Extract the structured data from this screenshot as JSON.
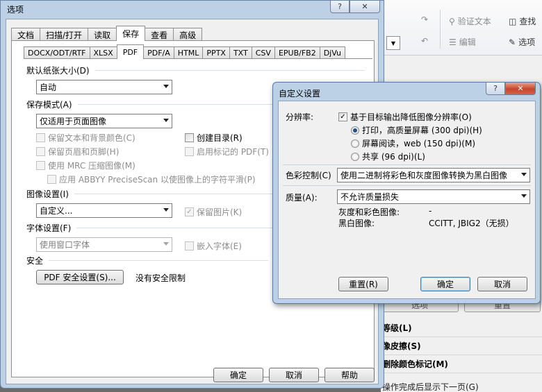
{
  "bg": {
    "toolbar": {
      "verify_text": "验证文本",
      "find": "查找",
      "edit": "编辑",
      "options": "选项"
    },
    "hidden_buttons": [
      "选项",
      "重置"
    ],
    "list_items": [
      "等级(L)",
      "像皮擦(S)",
      "删除颜色标记(M)"
    ],
    "bottom_text": "操作完成后显示下一页(G)"
  },
  "main": {
    "title": "选项",
    "help_glyph": "?",
    "close_glyph": "✕",
    "tabs": [
      "文档",
      "扫描/打开",
      "读取",
      "保存",
      "查看",
      "高级"
    ],
    "active_tab": "保存",
    "format_tabs": [
      "DOCX/ODT/RTF",
      "XLSX",
      "PDF",
      "PDF/A",
      "HTML",
      "PPTX",
      "TXT",
      "CSV",
      "EPUB/FB2",
      "DjVu"
    ],
    "active_format": "PDF",
    "paper_size": {
      "label": "默认纸张大小(D)",
      "value": "自动"
    },
    "save_mode": {
      "label": "保存模式(A)",
      "value": "仅适用于页面图像"
    },
    "checks": {
      "keep_text_bg": {
        "label": "保留文本和背景颜色(C)",
        "checked": false,
        "enabled": false
      },
      "keep_header_footer": {
        "label": "保留页眉和页脚(H)",
        "checked": false,
        "enabled": false
      },
      "use_mrc": {
        "label": "使用 MRC 压缩图像(M)",
        "checked": false,
        "enabled": false
      },
      "abbyy_smooth": {
        "label": "应用 ABBYY PreciseScan 以使图像上的字符平滑(P)",
        "checked": false,
        "enabled": false
      },
      "create_toc": {
        "label": "创建目录(R)",
        "checked": false,
        "enabled": true
      },
      "tagged_pdf": {
        "label": "启用标记的 PDF(T)",
        "checked": false,
        "enabled": false
      },
      "keep_images": {
        "label": "保留图片(K)",
        "checked": true,
        "enabled": false
      },
      "embed_fonts": {
        "label": "嵌入字体(E)",
        "checked": false,
        "enabled": false
      }
    },
    "image_settings": {
      "label": "图像设置(I)",
      "value": "自定义..."
    },
    "font_settings": {
      "label": "字体设置(F)",
      "value": "使用窗口字体"
    },
    "security": {
      "label": "安全",
      "button": "PDF 安全设置(S)...",
      "status": "没有安全限制"
    },
    "buttons": {
      "ok": "确定",
      "cancel": "取消",
      "help": "帮助"
    }
  },
  "dialog": {
    "title": "自定义设置",
    "help_glyph": "?",
    "close_glyph": "✕",
    "resolution": {
      "label": "分辨率:",
      "reduce_check": "基于目标输出降低图像分辨率(O)",
      "reduce_checked": true,
      "options": [
        {
          "label": "打印，高质量屏幕 (300 dpi)(H)",
          "selected": true
        },
        {
          "label": "屏幕阅读，web (150 dpi)(M)",
          "selected": false
        },
        {
          "label": "共享 (96 dpi)(L)",
          "selected": false
        }
      ]
    },
    "color_control": {
      "label": "色彩控制(C)",
      "value": "使用二进制将彩色和灰度图像转换为黑白图像"
    },
    "quality": {
      "label": "质量(A):",
      "value": "不允许质量损失",
      "gray_color_label": "灰度和彩色图像:",
      "gray_color_value": "-",
      "bw_label": "黑白图像:",
      "bw_value": "CCITT, JBIG2（无损）"
    },
    "buttons": {
      "reset": "重置(R)",
      "ok": "确定",
      "cancel": "取消"
    }
  }
}
